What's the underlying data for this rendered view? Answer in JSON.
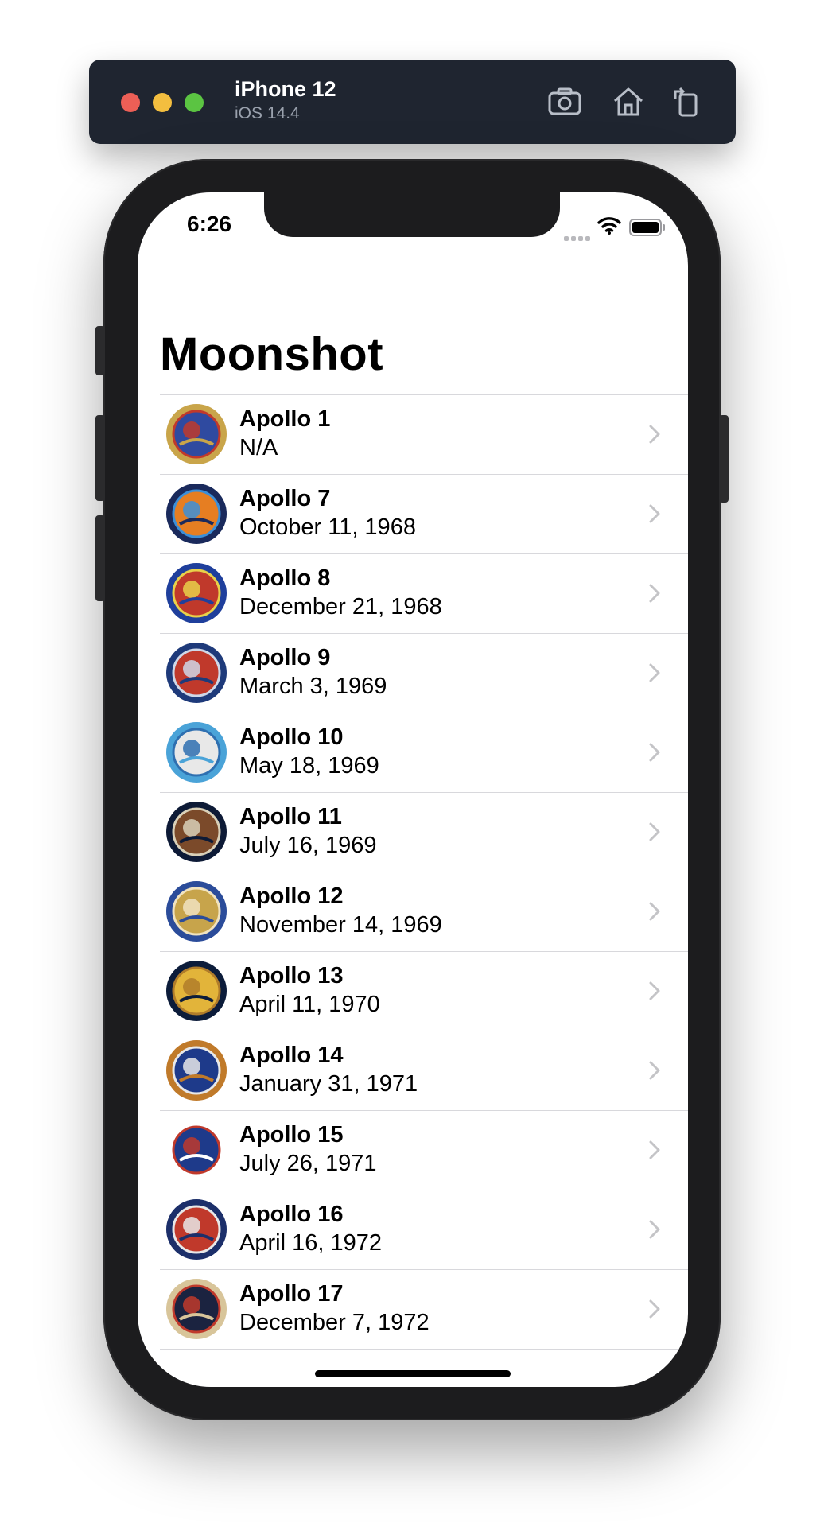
{
  "simulator": {
    "device_name": "iPhone 12",
    "os_version": "iOS 14.4",
    "buttons": [
      {
        "icon": "screenshot-icon"
      },
      {
        "icon": "home-icon"
      },
      {
        "icon": "rotate-icon"
      }
    ]
  },
  "status_bar": {
    "time": "6:26"
  },
  "nav": {
    "title": "Moonshot"
  },
  "missions": [
    {
      "name": "Apollo 1",
      "date": "N/A",
      "badge_colors": [
        "#c9a54a",
        "#2f4aa0",
        "#c0392b"
      ]
    },
    {
      "name": "Apollo 7",
      "date": "October 11, 1968",
      "badge_colors": [
        "#1a2a5c",
        "#e67e22",
        "#3c8fd8"
      ]
    },
    {
      "name": "Apollo 8",
      "date": "December 21, 1968",
      "badge_colors": [
        "#1f3f9c",
        "#c0392b",
        "#e8d14a"
      ]
    },
    {
      "name": "Apollo 9",
      "date": "March 3, 1969",
      "badge_colors": [
        "#1e3a7a",
        "#c0392b",
        "#cfd8e8"
      ]
    },
    {
      "name": "Apollo 10",
      "date": "May 18, 1969",
      "badge_colors": [
        "#4aa3d8",
        "#e8e8e8",
        "#2e6fb0"
      ]
    },
    {
      "name": "Apollo 11",
      "date": "July 16, 1969",
      "badge_colors": [
        "#0d1a36",
        "#7b4a2a",
        "#d9d0b8"
      ]
    },
    {
      "name": "Apollo 12",
      "date": "November 14, 1969",
      "badge_colors": [
        "#2b4c9a",
        "#c7a44b",
        "#f0e3c0"
      ]
    },
    {
      "name": "Apollo 13",
      "date": "April 11, 1970",
      "badge_colors": [
        "#0c1c3a",
        "#e2b43a",
        "#b07c2a"
      ]
    },
    {
      "name": "Apollo 14",
      "date": "January 31, 1971",
      "badge_colors": [
        "#c07a2a",
        "#1e3a8a",
        "#e8e8e8"
      ]
    },
    {
      "name": "Apollo 15",
      "date": "July 26, 1971",
      "badge_colors": [
        "#ffffff",
        "#1e3a8a",
        "#c0392b"
      ]
    },
    {
      "name": "Apollo 16",
      "date": "April 16, 1972",
      "badge_colors": [
        "#1c2f6a",
        "#c0392b",
        "#e8e8e8"
      ]
    },
    {
      "name": "Apollo 17",
      "date": "December 7, 1972",
      "badge_colors": [
        "#d8c59a",
        "#1b2340",
        "#c0392b"
      ]
    }
  ]
}
